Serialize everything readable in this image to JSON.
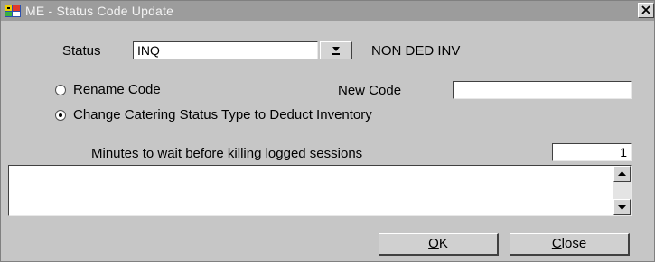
{
  "window": {
    "title": "ME - Status Code Update",
    "close_glyph": "✕",
    "icon": "app-icon"
  },
  "form": {
    "status_label": "Status",
    "status_value": "INQ",
    "status_description": "NON DED INV",
    "rename_option_label": "Rename Code",
    "rename_selected": false,
    "new_code_label": "New Code",
    "new_code_value": "",
    "change_option_label": "Change Catering Status Type to Deduct Inventory",
    "change_selected": true,
    "minutes_label": "Minutes to wait before killing logged sessions",
    "minutes_value": "1",
    "memo_text": ""
  },
  "buttons": {
    "ok_accel": "O",
    "ok_rest": "K",
    "close_accel": "C",
    "close_rest": "lose"
  }
}
